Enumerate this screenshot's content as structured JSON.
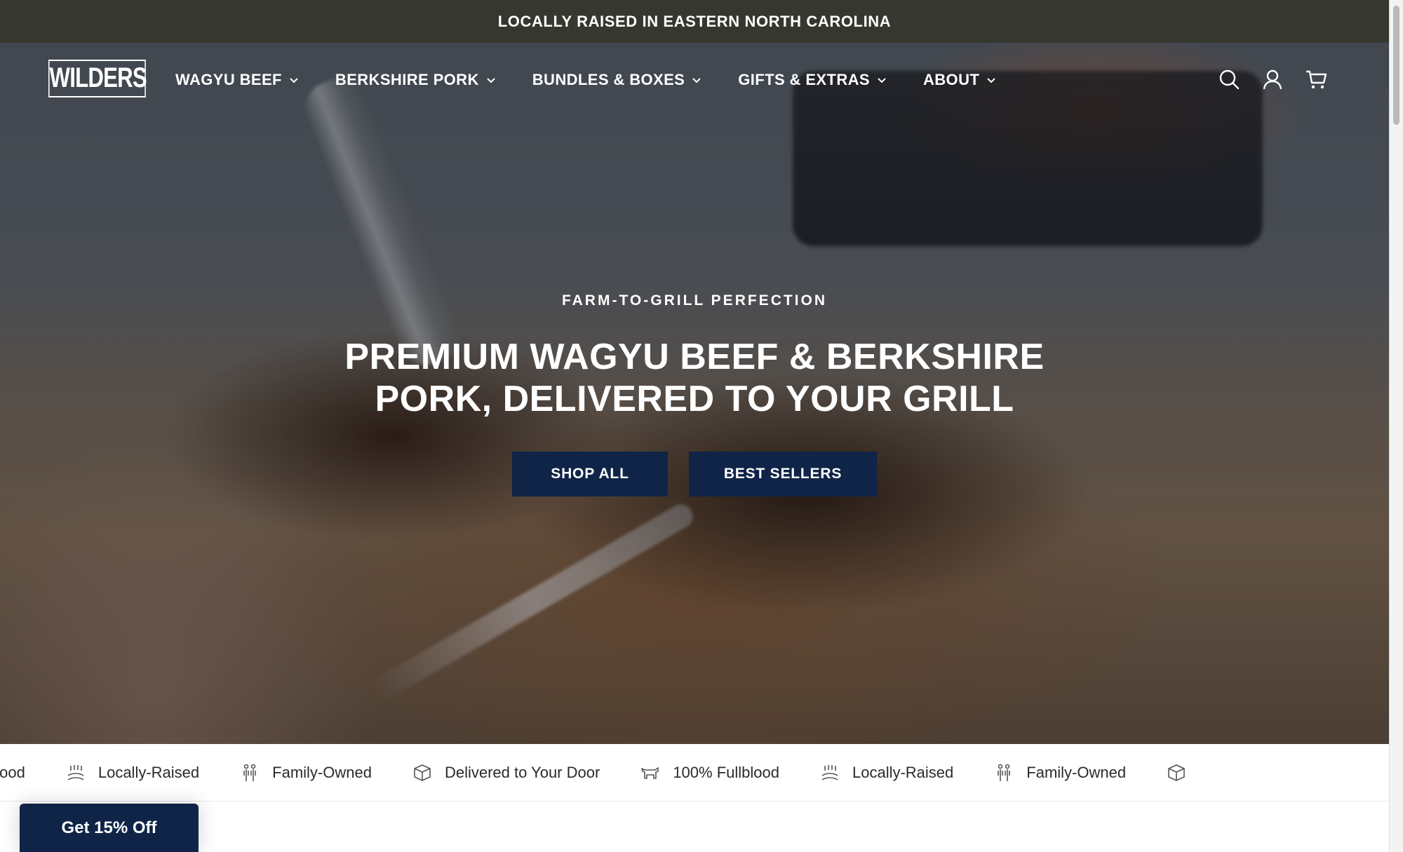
{
  "announcement": {
    "text": "LOCALLY RAISED IN EASTERN NORTH CAROLINA"
  },
  "header": {
    "logo_text": "WILDERS",
    "nav": [
      {
        "label": "WAGYU BEEF"
      },
      {
        "label": "BERKSHIRE PORK"
      },
      {
        "label": "BUNDLES & BOXES"
      },
      {
        "label": "GIFTS & EXTRAS"
      },
      {
        "label": "ABOUT"
      }
    ],
    "icons": [
      "search-icon",
      "account-icon",
      "cart-icon"
    ]
  },
  "hero": {
    "eyebrow": "FARM-TO-GRILL PERFECTION",
    "headline_line1": "PREMIUM WAGYU BEEF & BERKSHIRE",
    "headline_line2": "PORK, DELIVERED TO YOUR GRILL",
    "buttons": {
      "shop_all": "SHOP ALL",
      "best_sellers": "BEST SELLERS"
    },
    "button_color": "#0f2447"
  },
  "marquee": {
    "items": [
      {
        "label": "ullblood",
        "icon": "cow-icon"
      },
      {
        "label": "Locally-Raised",
        "icon": "field-icon"
      },
      {
        "label": "Family-Owned",
        "icon": "family-icon"
      },
      {
        "label": "Delivered to Your Door",
        "icon": "box-icon"
      },
      {
        "label": "100% Fullblood",
        "icon": "cow-icon"
      },
      {
        "label": "Locally-Raised",
        "icon": "field-icon"
      },
      {
        "label": "Family-Owned",
        "icon": "family-icon"
      },
      {
        "label": "",
        "icon": "box-icon"
      }
    ]
  },
  "promo": {
    "label": "Get 15% Off"
  },
  "colors": {
    "announcement_bg": "#36372f",
    "navy": "#0f2447"
  }
}
